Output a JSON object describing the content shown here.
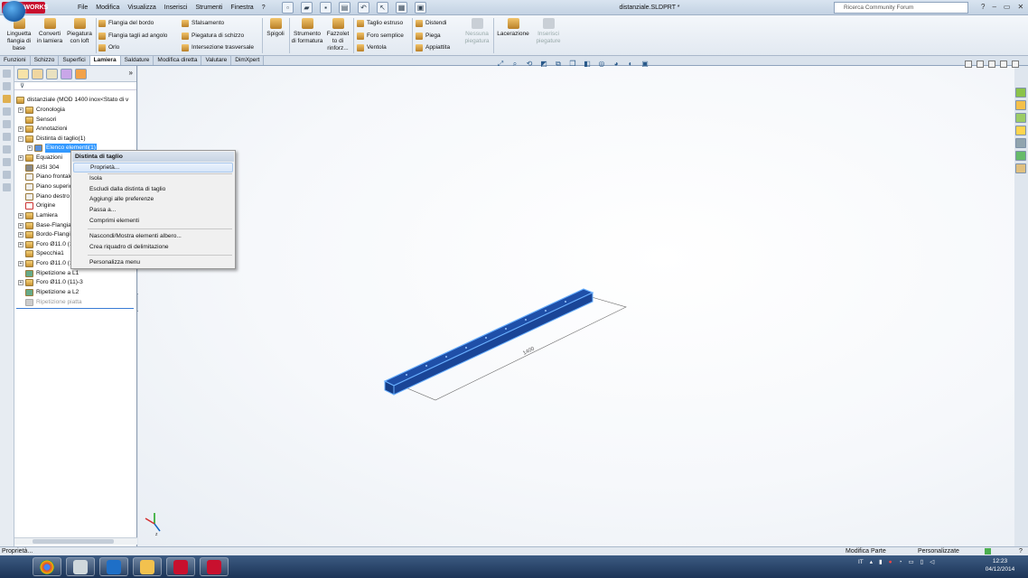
{
  "app": {
    "logo": "SOLIDWORKS",
    "menus": [
      "File",
      "Modifica",
      "Visualizza",
      "Inserisci",
      "Strumenti",
      "Finestra",
      "?"
    ],
    "document_title": "distanziale.SLDPRT *",
    "search_placeholder": "Ricerca Community Forum"
  },
  "commandmanager": {
    "big": [
      {
        "label": "Linguetta flangia di base"
      },
      {
        "label": "Converti in lamiera"
      },
      {
        "label": "Piegatura con loft"
      },
      {
        "label": "Spigoli"
      },
      {
        "label": "Strumento di formatura"
      },
      {
        "label": "Fazzolet to di rinforz..."
      },
      {
        "label": "Lacerazione"
      },
      {
        "label": "Nessuna piegatura"
      },
      {
        "label": "Inserisci piegature"
      }
    ],
    "small": [
      "Flangia del bordo",
      "Flangia tagli ad angolo",
      "Orlo",
      "Sfalsamento",
      "Piegatura di schizzo",
      "Intersezione trasversale",
      "Taglio estruso",
      "Foro semplice",
      "Ventola",
      "Distendi",
      "Piega",
      "Appiattita"
    ]
  },
  "tabs": [
    "Funzioni",
    "Schizzo",
    "Superfici",
    "Lamiera",
    "Saldature",
    "Modifica diretta",
    "Valutare",
    "DimXpert"
  ],
  "active_tab": "Lamiera",
  "tree": {
    "root": "distanziale (MOD 1400 inox<Stato di v",
    "items": [
      "Cronologia",
      "Sensori",
      "Annotazioni",
      "Distinta di taglio(1)",
      "Elenco elementi(1)",
      "Equazioni",
      "AISI 304",
      "Piano frontale",
      "Piano superiore",
      "Piano destro",
      "Origine",
      "Lamiera",
      "Base-Flangia1",
      "Bordo-Flangia1",
      "Foro Ø11.0 (11)1",
      "Specchia1",
      "Foro Ø11.0 (11)2",
      "Ripetizione a L1",
      "Foro Ø11.0 (11)-3",
      "Ripetizione a L2",
      "Ripetizione piatta"
    ]
  },
  "context_menu": {
    "title": "Distinta di taglio",
    "items": [
      "Proprietà...",
      "Isola",
      "Escludi dalla distinta di taglio",
      "Aggiungi alle preferenze",
      "Passa a...",
      "Comprimi elementi",
      "Nascondi/Mostra elementi albero...",
      "Crea riquadro di delimitazione",
      "Personalizza menu"
    ]
  },
  "model": {
    "dimension_text": "1400"
  },
  "status": {
    "left": "Proprietà...",
    "mode": "Modifica Parte",
    "units": "Personalizzate"
  },
  "system": {
    "language": "IT",
    "time": "12:23",
    "date": "04/12/2014"
  },
  "colors": {
    "accent": "#3399ff",
    "model_blue": "#1f4fa8",
    "brand_red": "#c8102e"
  }
}
